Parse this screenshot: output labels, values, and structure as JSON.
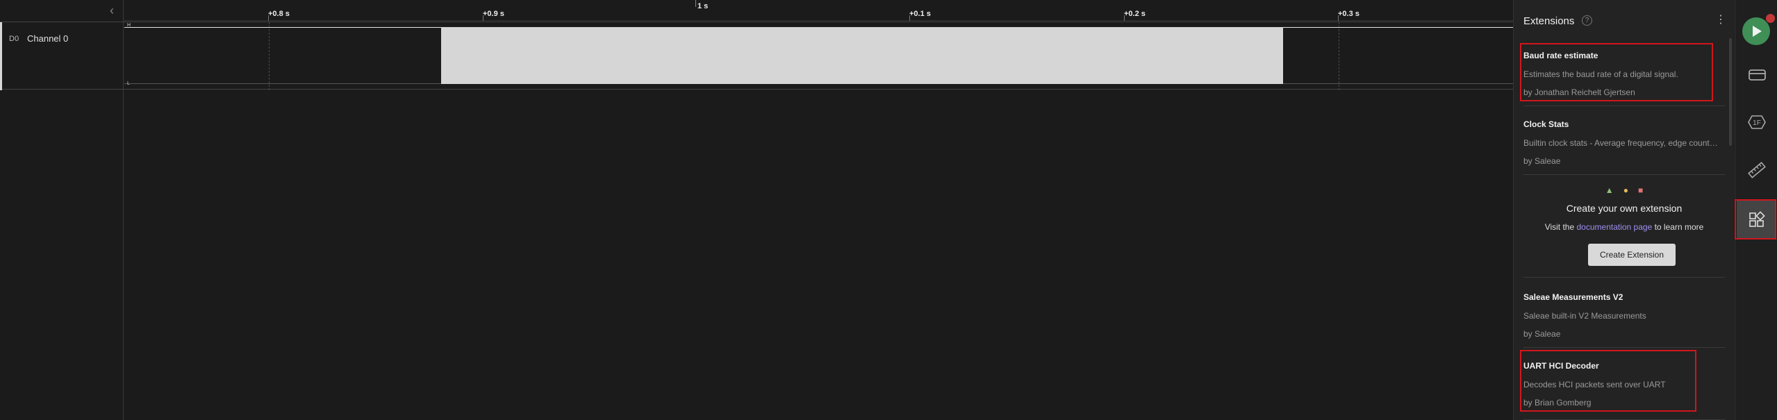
{
  "ruler": {
    "ticks": [
      "+0.8 s",
      "+0.9 s",
      "+0.1 s",
      "+0.2 s",
      "+0.3 s"
    ],
    "center_label": "1 s"
  },
  "channel": {
    "id": "D0",
    "name": "Channel 0",
    "high_marker": "H",
    "low_marker": "L"
  },
  "panel": {
    "title": "Extensions",
    "extensions": [
      {
        "name": "Baud rate estimate",
        "description": "Estimates the baud rate of a digital signal.",
        "author": "by Jonathan Reichelt Gjertsen"
      },
      {
        "name": "Clock Stats",
        "description": "Builtin clock stats - Average frequency, edge count, etc",
        "author": "by Saleae"
      },
      {
        "name": "Saleae Measurements V2",
        "description": "Saleae built-in V2 Measurements",
        "author": "by Saleae"
      },
      {
        "name": "UART HCI Decoder",
        "description": "Decodes HCI packets sent over UART",
        "author": "by Brian Gomberg"
      }
    ],
    "create": {
      "title": "Create your own extension",
      "text_before": "Visit the",
      "link": "documentation page",
      "text_after": "to learn more",
      "button": "Create Extension"
    }
  },
  "toolbar": {
    "icons": [
      "run-icon",
      "device-icon",
      "analyzer-icon",
      "measurement-icon",
      "extensions-icon"
    ]
  },
  "colors": {
    "highlight": "#d1161c",
    "run": "#3f8f56",
    "link": "#9f8ff0"
  }
}
